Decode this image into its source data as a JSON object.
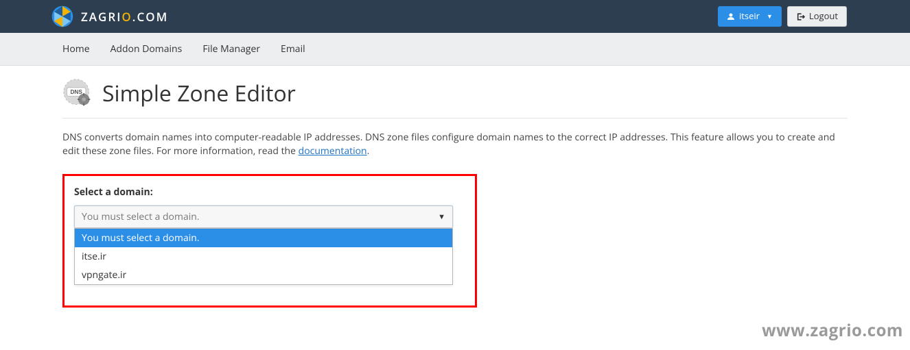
{
  "header": {
    "brand_text_pre": "ZAGRI",
    "brand_text_accent": "O",
    "brand_text_post": ".COM",
    "user_label": "itseir",
    "logout_label": "Logout"
  },
  "nav": {
    "items": [
      "Home",
      "Addon Domains",
      "File Manager",
      "Email"
    ]
  },
  "page": {
    "title": "Simple Zone Editor",
    "description_pre": "DNS converts domain names into computer-readable IP addresses. DNS zone files configure domain names to the correct IP addresses. This feature allows you to create and edit these zone files. For more information, read the ",
    "description_link": "documentation",
    "description_post": "."
  },
  "domain_select": {
    "label": "Select a domain:",
    "placeholder": "You must select a domain.",
    "options": [
      {
        "label": "You must select a domain.",
        "selected": true
      },
      {
        "label": "itse.ir",
        "selected": false
      },
      {
        "label": "vpngate.ir",
        "selected": false
      }
    ]
  },
  "watermark": "www.zagrio.com"
}
